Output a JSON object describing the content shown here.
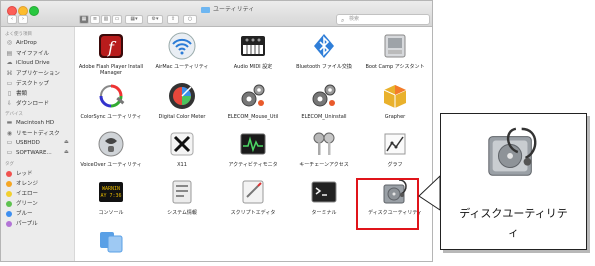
{
  "window": {
    "title": "ユーティリティ"
  },
  "search": {
    "placeholder": "検索"
  },
  "sidebar": {
    "favorites_header": "よく使う項目",
    "favorites": [
      {
        "label": "AirDrop",
        "icon": "airdrop-icon"
      },
      {
        "label": "マイファイル",
        "icon": "all-files-icon"
      },
      {
        "label": "iCloud Drive",
        "icon": "cloud-icon"
      },
      {
        "label": "アプリケーション",
        "icon": "applications-icon"
      },
      {
        "label": "デスクトップ",
        "icon": "desktop-icon"
      },
      {
        "label": "書類",
        "icon": "documents-icon"
      },
      {
        "label": "ダウンロード",
        "icon": "downloads-icon"
      }
    ],
    "devices_header": "デバイス",
    "devices": [
      {
        "label": "Macintosh HD",
        "icon": "hard-disk-icon"
      },
      {
        "label": "リモートディスク",
        "icon": "remote-disc-icon"
      },
      {
        "label": "USBHDD",
        "icon": "external-drive-icon"
      },
      {
        "label": "SOFTWARE...",
        "icon": "external-drive-icon"
      }
    ],
    "tags_header": "タグ",
    "tags": [
      {
        "label": "レッド",
        "color": "#f0524f"
      },
      {
        "label": "オレンジ",
        "color": "#f5a623"
      },
      {
        "label": "イエロー",
        "color": "#f2cf2e"
      },
      {
        "label": "グリーン",
        "color": "#5ec24f"
      },
      {
        "label": "ブルー",
        "color": "#3e8ff0"
      },
      {
        "label": "パープル",
        "color": "#b374d6"
      }
    ]
  },
  "apps": [
    {
      "label": "Adobe Flash Player Install Manager",
      "icon": "flash-icon"
    },
    {
      "label": "AirMac ユーティリティ",
      "icon": "wifi-icon"
    },
    {
      "label": "Audio MIDI 設定",
      "icon": "midi-keyboard-icon"
    },
    {
      "label": "Bluetooth ファイル交換",
      "icon": "bluetooth-icon"
    },
    {
      "label": "Boot Camp アシスタント",
      "icon": "bootcamp-icon"
    },
    {
      "label": "ColorSync ユーティリティ",
      "icon": "colorsync-icon"
    },
    {
      "label": "Digital Color Meter",
      "icon": "color-meter-icon"
    },
    {
      "label": "ELECOM_Mouse_Util",
      "icon": "gears-icon"
    },
    {
      "label": "ELECOM_Uninstall",
      "icon": "gears-icon"
    },
    {
      "label": "Grapher",
      "icon": "grapher-icon"
    },
    {
      "label": "VoiceOver ユーティリティ",
      "icon": "voiceover-icon"
    },
    {
      "label": "X11",
      "icon": "x11-icon"
    },
    {
      "label": "アクティビティモニタ",
      "icon": "activity-monitor-icon"
    },
    {
      "label": "キーチェーンアクセス",
      "icon": "keychain-icon"
    },
    {
      "label": "グラフ",
      "icon": "graph-icon"
    },
    {
      "label": "コンソール",
      "icon": "console-icon"
    },
    {
      "label": "システム情報",
      "icon": "system-info-icon"
    },
    {
      "label": "スクリプトエディタ",
      "icon": "script-editor-icon"
    },
    {
      "label": "ターミナル",
      "icon": "terminal-icon"
    },
    {
      "label": "ディスクユーティリティ",
      "icon": "disk-utility-icon"
    },
    {
      "label": "",
      "icon": "migration-assistant-icon"
    }
  ],
  "callout": {
    "label_line1": "ディスクユーティリテ",
    "label_line2": "ィ",
    "icon": "disk-utility-icon"
  }
}
